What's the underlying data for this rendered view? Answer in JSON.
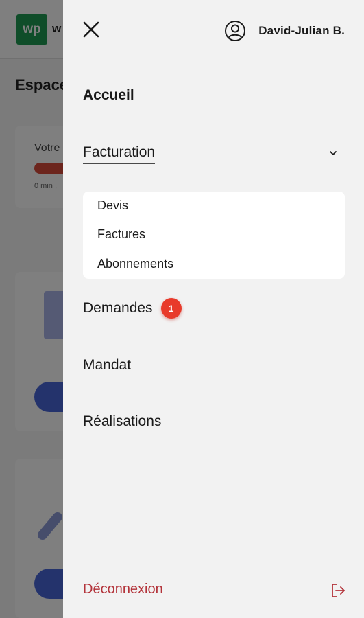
{
  "background": {
    "logo_text": "wp",
    "logo_partial": "w",
    "page_title_partial": "Espace",
    "card_label_partial": "Votre",
    "card_small_partial": "0 min ,"
  },
  "drawer": {
    "user_name": "David-Julian B.",
    "menu": {
      "accueil": "Accueil",
      "facturation": "Facturation",
      "facturation_submenu": [
        "Devis",
        "Factures",
        "Abonnements"
      ],
      "demandes": "Demandes",
      "demandes_badge": "1",
      "mandat": "Mandat",
      "realisations": "Réalisations"
    },
    "logout_label": "Déconnexion"
  },
  "colors": {
    "drawer_bg": "#f2f2f2",
    "badge": "#e83a2b",
    "logout": "#b3333a"
  },
  "icons": {
    "close": "close-icon",
    "user": "user-circle-icon",
    "chevron": "chevron-down-icon",
    "logout": "logout-icon"
  }
}
